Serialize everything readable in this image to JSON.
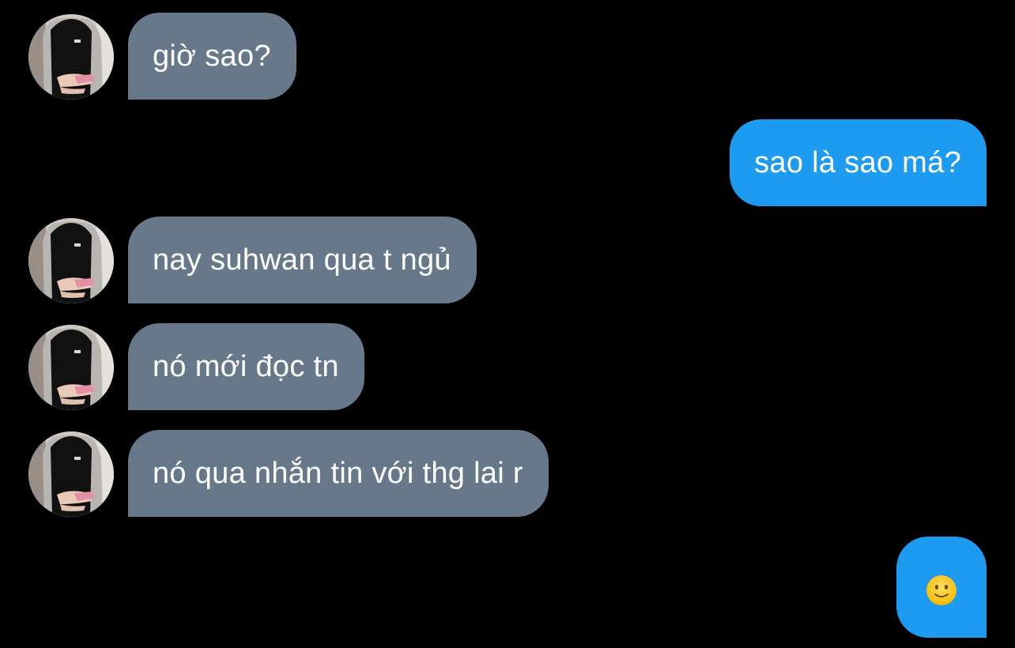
{
  "conversation": {
    "messages": [
      {
        "direction": "received",
        "text": "giờ sao?"
      },
      {
        "direction": "sent",
        "text": "sao là sao má?"
      },
      {
        "direction": "received",
        "text": "nay suhwan qua t ngủ"
      },
      {
        "direction": "received",
        "text": "nó mới đọc tn"
      },
      {
        "direction": "received",
        "text": "nó qua nhắn tin với thg lai r"
      },
      {
        "direction": "sent",
        "text": "",
        "emoji": "slightly-smiling-face"
      }
    ]
  },
  "colors": {
    "background": "#000000",
    "received_bubble": "#66788a",
    "sent_bubble": "#1d9bf0",
    "text": "#ffffff"
  }
}
